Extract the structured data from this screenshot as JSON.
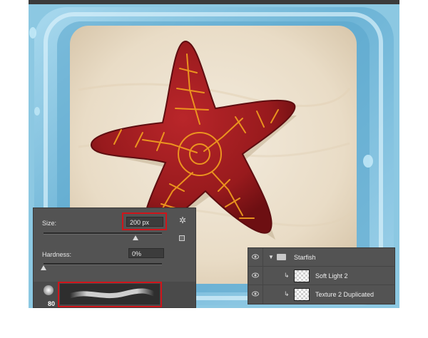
{
  "brush_panel": {
    "size_label": "Size:",
    "size_value": "200 px",
    "hardness_label": "Hardness:",
    "hardness_value": "0%",
    "size_slider_level": 0.78,
    "hardness_slider_level": 0.0,
    "preset_number": "80",
    "gear_icon": "gear-icon",
    "new_preset_icon": "new-preset-icon",
    "highlight_color": "#d0141a"
  },
  "layers": {
    "items": [
      {
        "name": "Starfish",
        "type": "group",
        "expanded": true
      },
      {
        "name": "Soft Light 2",
        "type": "layer",
        "clipped": true
      },
      {
        "name": "Texture 2 Duplicated",
        "type": "layer",
        "clipped": true
      }
    ]
  },
  "colors": {
    "starfish": "#9a1a1c",
    "crack_lines": "#f3a11f",
    "sand": "#efe4d2",
    "ice": "#7fbfdc",
    "panel_bg": "#535353"
  }
}
